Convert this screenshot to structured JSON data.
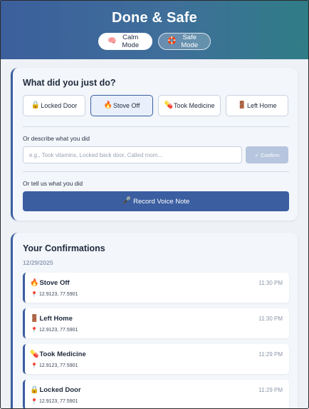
{
  "app": {
    "title": "Done & Safe",
    "modes": [
      {
        "icon": "brain-icon",
        "glyph": "🧠",
        "label": "Calm Mode"
      },
      {
        "icon": "lifebuoy-icon",
        "glyph": "🛟",
        "label": "Safe Mode"
      }
    ]
  },
  "actions": {
    "heading": "What did you just do?",
    "buttons": [
      {
        "icon": "lock-icon",
        "glyph": "🔒",
        "label": "Locked Door",
        "selected": false
      },
      {
        "icon": "fire-icon",
        "glyph": "🔥",
        "label": "Stove Off",
        "selected": true
      },
      {
        "icon": "pill-icon",
        "glyph": "💊",
        "label": "Took Medicine",
        "selected": false
      },
      {
        "icon": "door-icon",
        "glyph": "🚪",
        "label": "Left Home",
        "selected": false
      }
    ],
    "describe_label": "Or describe what you did",
    "describe_placeholder": "e.g., Took vitamins, Locked back door, Called mom...",
    "confirm_label": "Confirm",
    "confirm_glyph": "✓",
    "voice_label": "Or tell us what you did",
    "voice_button": "Record Voice Note",
    "voice_glyph": "🎤"
  },
  "confirmations": {
    "heading": "Your Confirmations",
    "date": "12/29/2025",
    "entries": [
      {
        "icon": "fire-icon",
        "glyph": "🔥",
        "title": "Stove Off",
        "time": "11:30 PM",
        "location": "12.9123, 77.5901"
      },
      {
        "icon": "door-icon",
        "glyph": "🚪",
        "title": "Left Home",
        "time": "11:30 PM",
        "location": "12.9123, 77.5901"
      },
      {
        "icon": "pill-icon",
        "glyph": "💊",
        "title": "Took Medicine",
        "time": "11:29 PM",
        "location": "12.9123, 77.5901"
      },
      {
        "icon": "lock-icon",
        "glyph": "🔒",
        "title": "Locked Door",
        "time": "11:29 PM",
        "location": "12.9123, 77.5901"
      }
    ],
    "pin_glyph": "📍"
  },
  "colors": {
    "accent": "#3b5ea1",
    "header_start": "#3b5f9c",
    "header_end": "#2f7c86",
    "confirm_disabled": "#b7c6de"
  }
}
